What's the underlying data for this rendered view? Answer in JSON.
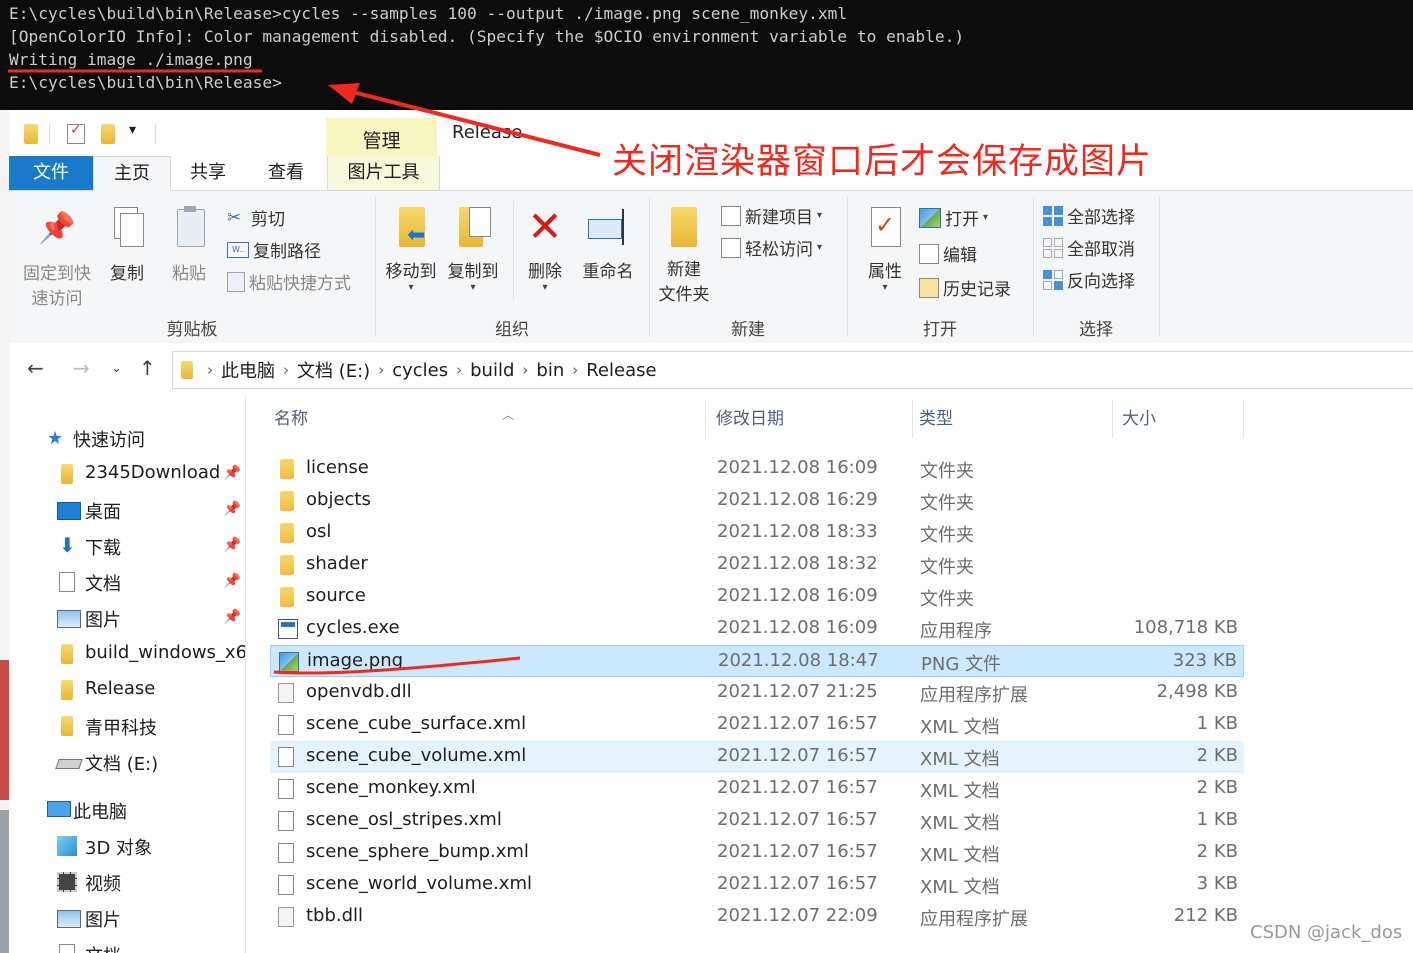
{
  "terminal": {
    "lines": [
      "E:\\cycles\\build\\bin\\Release>cycles --samples 100 --output ./image.png scene_monkey.xml",
      "[OpenColorIO Info]: Color management disabled. (Specify the $OCIO environment variable to enable.)",
      "Writing image ./image.png",
      "E:\\cycles\\build\\bin\\Release>"
    ]
  },
  "annotation": {
    "text": "关闭渲染器窗口后才会保存成图片",
    "color": "#ee2a1f"
  },
  "window": {
    "title": "Release",
    "context_tab": "管理",
    "context_subtab": "图片工具"
  },
  "tabs": {
    "file": "文件",
    "home": "主页",
    "share": "共享",
    "view": "查看"
  },
  "ribbon": {
    "clipboard": {
      "title": "剪贴板",
      "pin_line1": "固定到快",
      "pin_line2": "速访问",
      "copy": "复制",
      "paste": "粘贴",
      "cut": "剪切",
      "copy_path": "复制路径",
      "paste_shortcut": "粘贴快捷方式"
    },
    "organize": {
      "title": "组织",
      "move_to": "移动到",
      "copy_to": "复制到",
      "delete": "删除",
      "rename": "重命名"
    },
    "new": {
      "title": "新建",
      "new_folder_line1": "新建",
      "new_folder_line2": "文件夹",
      "new_item": "新建项目",
      "easy_access": "轻松访问"
    },
    "open": {
      "title": "打开",
      "properties": "属性",
      "open": "打开",
      "edit": "编辑",
      "history": "历史记录"
    },
    "select": {
      "title": "选择",
      "select_all": "全部选择",
      "select_none": "全部取消",
      "invert": "反向选择"
    }
  },
  "address": {
    "crumbs": [
      "此电脑",
      "文档 (E:)",
      "cycles",
      "build",
      "bin",
      "Release"
    ]
  },
  "nav": {
    "quick_access": "快速访问",
    "quick_items": [
      "2345Download",
      "桌面",
      "下载",
      "文档",
      "图片",
      "build_windows_x6",
      "Release",
      "青甲科技",
      "文档 (E:)"
    ],
    "this_pc": "此电脑",
    "pc_items": [
      "3D 对象",
      "视频",
      "图片",
      "文档"
    ]
  },
  "columns": {
    "name": "名称",
    "date": "修改日期",
    "type": "类型",
    "size": "大小"
  },
  "files": [
    {
      "name": "license",
      "date": "2021.12.08 16:09",
      "type": "文件夹",
      "size": "",
      "icon": "folder-icon"
    },
    {
      "name": "objects",
      "date": "2021.12.08 16:29",
      "type": "文件夹",
      "size": "",
      "icon": "folder-icon"
    },
    {
      "name": "osl",
      "date": "2021.12.08 18:33",
      "type": "文件夹",
      "size": "",
      "icon": "folder-icon"
    },
    {
      "name": "shader",
      "date": "2021.12.08 18:32",
      "type": "文件夹",
      "size": "",
      "icon": "folder-icon"
    },
    {
      "name": "source",
      "date": "2021.12.08 16:09",
      "type": "文件夹",
      "size": "",
      "icon": "folder-icon"
    },
    {
      "name": "cycles.exe",
      "date": "2021.12.08 16:09",
      "type": "应用程序",
      "size": "108,718 KB",
      "icon": "exe-icon"
    },
    {
      "name": "image.png",
      "date": "2021.12.08 18:47",
      "type": "PNG 文件",
      "size": "323 KB",
      "icon": "image-icon"
    },
    {
      "name": "openvdb.dll",
      "date": "2021.12.07 21:25",
      "type": "应用程序扩展",
      "size": "2,498 KB",
      "icon": "dll-icon"
    },
    {
      "name": "scene_cube_surface.xml",
      "date": "2021.12.07 16:57",
      "type": "XML 文档",
      "size": "1 KB",
      "icon": "xml-icon"
    },
    {
      "name": "scene_cube_volume.xml",
      "date": "2021.12.07 16:57",
      "type": "XML 文档",
      "size": "2 KB",
      "icon": "xml-icon"
    },
    {
      "name": "scene_monkey.xml",
      "date": "2021.12.07 16:57",
      "type": "XML 文档",
      "size": "2 KB",
      "icon": "xml-icon"
    },
    {
      "name": "scene_osl_stripes.xml",
      "date": "2021.12.07 16:57",
      "type": "XML 文档",
      "size": "1 KB",
      "icon": "xml-icon"
    },
    {
      "name": "scene_sphere_bump.xml",
      "date": "2021.12.07 16:57",
      "type": "XML 文档",
      "size": "2 KB",
      "icon": "xml-icon"
    },
    {
      "name": "scene_world_volume.xml",
      "date": "2021.12.07 16:57",
      "type": "XML 文档",
      "size": "3 KB",
      "icon": "xml-icon"
    },
    {
      "name": "tbb.dll",
      "date": "2021.12.07 22:09",
      "type": "应用程序扩展",
      "size": "212 KB",
      "icon": "dll-icon"
    }
  ],
  "selected_file": "image.png",
  "hovered_file": "scene_cube_volume.xml",
  "watermark": "CSDN @jack_dos"
}
